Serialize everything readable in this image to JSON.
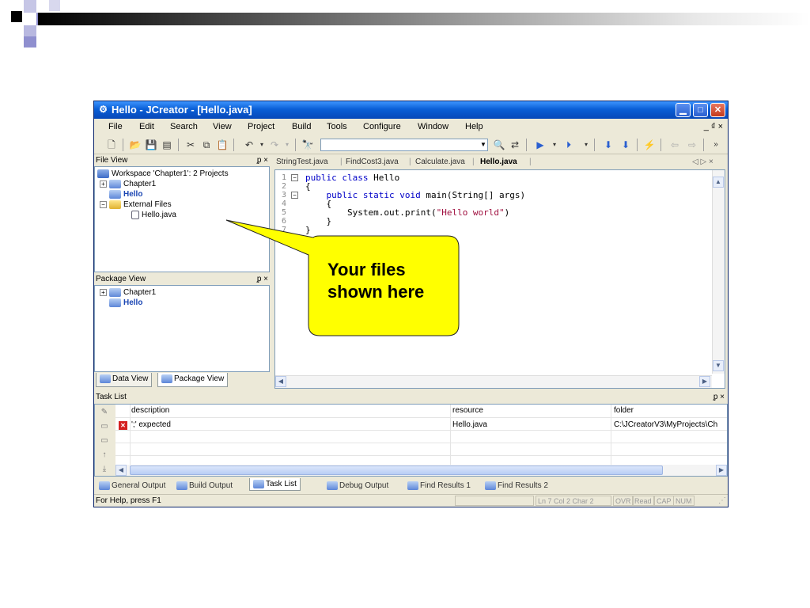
{
  "window": {
    "title": "Hello - JCreator - [Hello.java]",
    "app_icon": "jcreator-logo-icon",
    "controls": [
      "minimize",
      "maximize",
      "close"
    ]
  },
  "menubar": {
    "items": [
      "File",
      "Edit",
      "Search",
      "View",
      "Project",
      "Build",
      "Tools",
      "Configure",
      "Window",
      "Help"
    ],
    "right": "_ ₫ ×"
  },
  "file_view": {
    "title": "File View",
    "pin": "ᵱ ×",
    "workspace": "Workspace 'Chapter1': 2 Projects",
    "nodes": [
      "Chapter1",
      "Hello",
      "External Files",
      "Hello.java"
    ]
  },
  "package_view": {
    "title": "Package View",
    "pin": "ᵱ ×",
    "nodes": [
      "Chapter1",
      "Hello"
    ]
  },
  "left_tabs": [
    "Data View",
    "Package View"
  ],
  "editor": {
    "tabs": [
      "StringTest.java",
      "FindCost3.java",
      "Calculate.java",
      "Hello.java"
    ],
    "active_tab": "Hello.java",
    "nav": "◁ ▷ ×",
    "line_numbers": [
      "1",
      "2",
      "3",
      "4",
      "5",
      "6",
      "7"
    ],
    "lines": [
      {
        "kw": "public class",
        "rest": " Hello"
      },
      {
        "kw": "",
        "rest": "{"
      },
      {
        "kw": "    public static void",
        "rest": " main(String[] args)"
      },
      {
        "kw": "",
        "rest": "    {"
      },
      {
        "kw": "",
        "rest": "        System.out.print(",
        "str": "\"Hello world\"",
        "tail": ")"
      },
      {
        "kw": "",
        "rest": "    }"
      },
      {
        "kw": "",
        "rest": "}"
      }
    ]
  },
  "task_list": {
    "title": "Task List",
    "pin": "ᵱ ×",
    "columns": [
      "description",
      "resource",
      "folder"
    ],
    "rows": [
      {
        "description": "';' expected",
        "resource": "Hello.java",
        "folder": "C:\\JCreatorV3\\MyProjects\\Ch"
      }
    ]
  },
  "output_tabs": [
    "General Output",
    "Build Output",
    "Task List",
    "Debug Output",
    "Find Results 1",
    "Find Results 2"
  ],
  "active_output_tab": "Task List",
  "status": {
    "help": "For Help, press F1",
    "position": "Ln 7   Col 2   Char 2",
    "flags": [
      "OVR",
      "Read",
      "CAP",
      "NUM"
    ]
  },
  "callout": {
    "line1": "Your files",
    "line2": "shown here",
    "fill": "#ffff00"
  }
}
